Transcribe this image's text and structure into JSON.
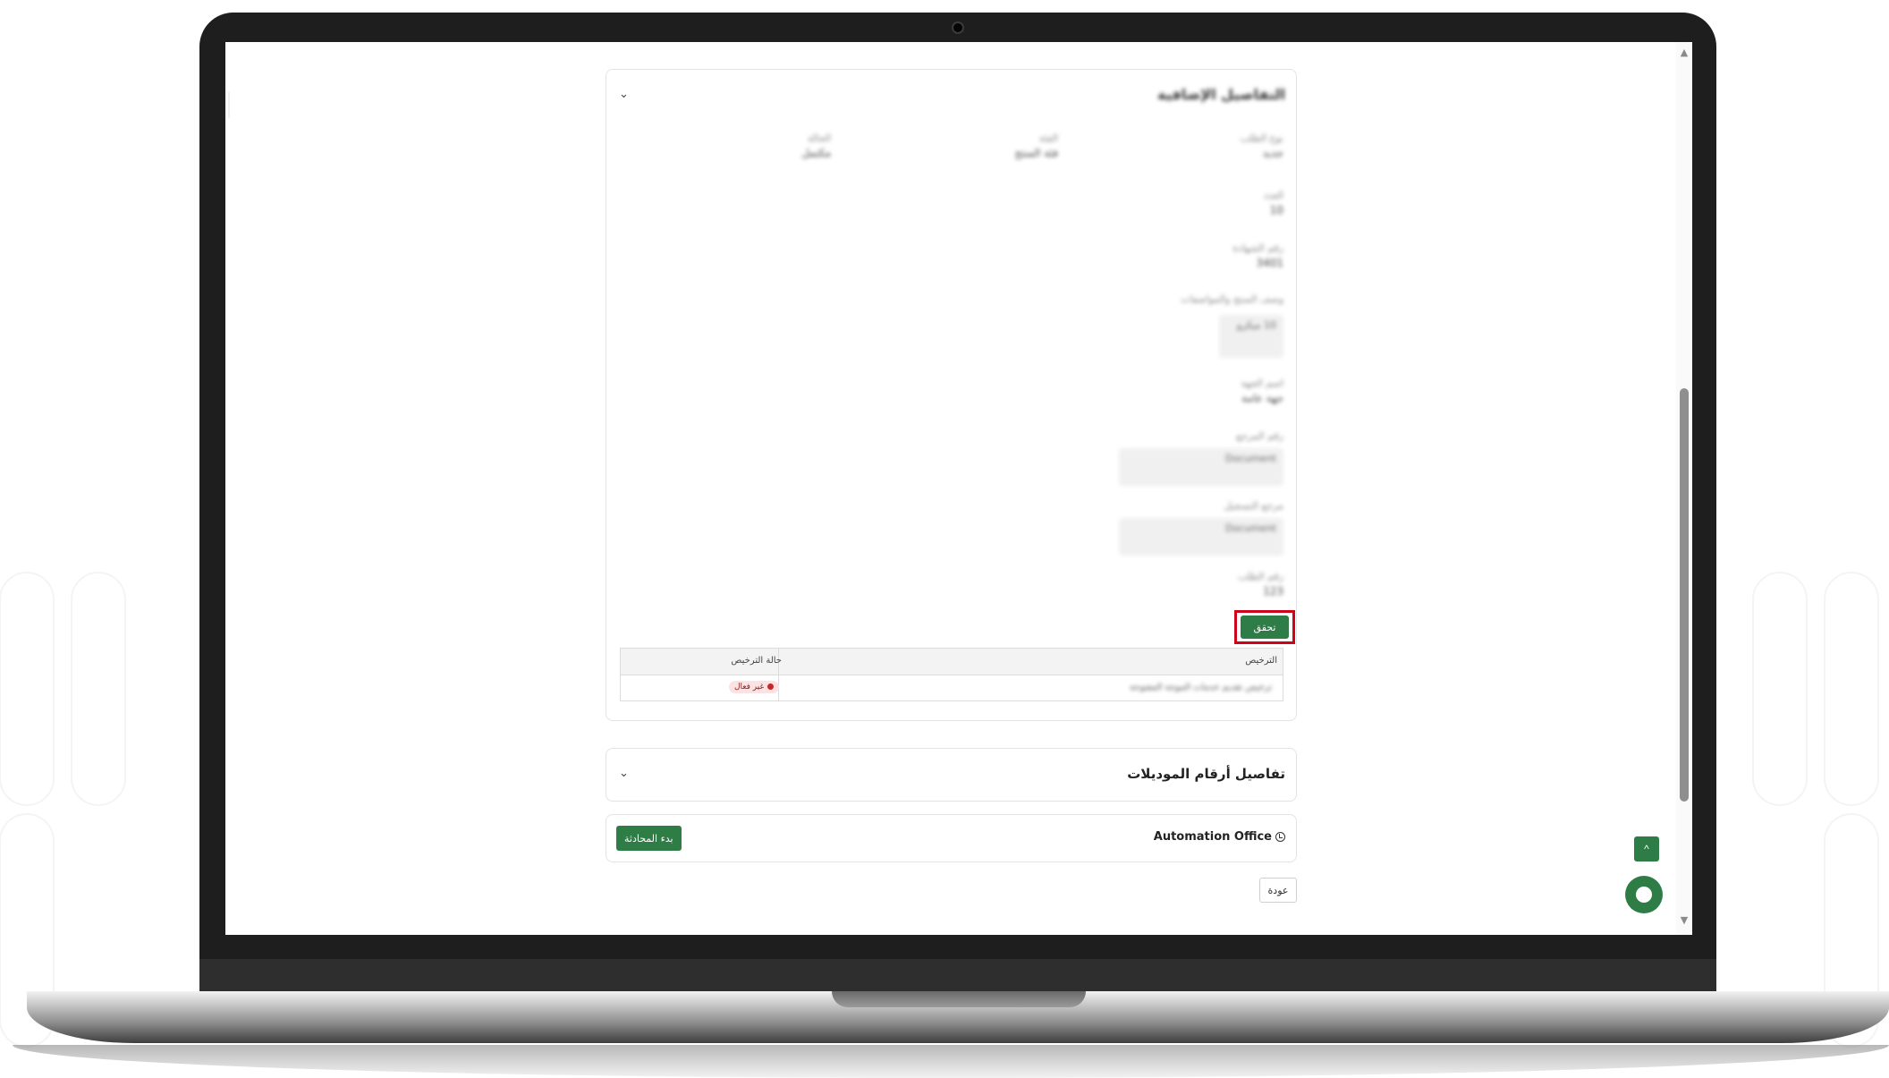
{
  "main_card": {
    "chevron": "⌄",
    "title": "التفاصيل الإضافية",
    "field_rows": [
      {
        "label": "نوع الطلب",
        "value": "جديد"
      },
      {
        "label": "الفئة",
        "value": "فئة المنتج"
      },
      {
        "label": "الحالة",
        "value": "مكتمل"
      }
    ],
    "fields_col": [
      {
        "label": "العدد",
        "value": "10"
      },
      {
        "label": "رقم الشهادة",
        "value": "3401"
      },
      {
        "label": "وصف المنتج والمواصفات",
        "value": "10 ميكرو"
      },
      {
        "label": "اسم الجهة",
        "value": "جهة عامة"
      },
      {
        "label": "رقم المرجع",
        "value": "Document"
      },
      {
        "label": "مرجع التسجيل",
        "value": "Document"
      },
      {
        "label": "رقم الطلب",
        "value": "123"
      }
    ],
    "verify_button": "تحقق",
    "table": {
      "headers": {
        "license": "الترخيص",
        "status": "حالة الترخيص"
      },
      "rows": [
        {
          "license": "ترخيص تقديم خدمات الموجة المفتوحة",
          "status": "غير فعال"
        }
      ]
    }
  },
  "models_card": {
    "title": "تفاصيل أرقام الموديلات",
    "chevron": "⌄"
  },
  "chat_card": {
    "office_name": "Automation Office",
    "start_chat_button": "بدء المحادثة"
  },
  "back_button": "عودة",
  "scroll_top_icon": "^",
  "scroll_up_arrow": "▲",
  "scroll_down_arrow": "▼",
  "colors": {
    "primary_green": "#2e7d46",
    "highlight_red": "#d0021b",
    "status_red": "#c62828"
  }
}
